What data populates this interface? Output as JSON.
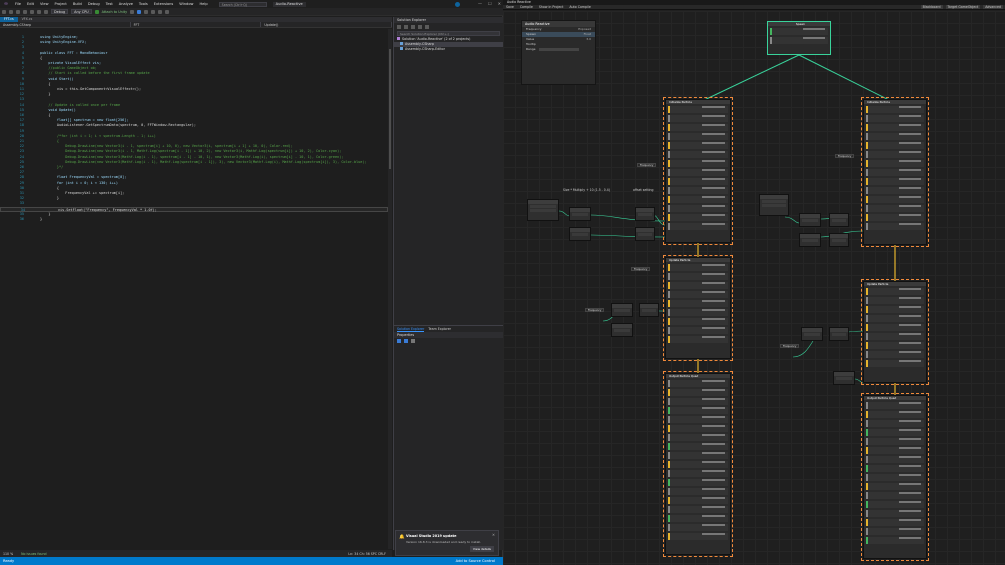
{
  "vs": {
    "menu": [
      "File",
      "Edit",
      "View",
      "Project",
      "Build",
      "Debug",
      "Test",
      "Analyze",
      "Tools",
      "Extensions",
      "Window",
      "Help"
    ],
    "search_placeholder": "Search (Ctrl+Q)",
    "title": "Audio-Reactive",
    "toolbar": {
      "config": "Debug",
      "platform": "Any CPU",
      "attach": "Attach to Unity"
    },
    "tabs": [
      "FFT.cs",
      "VFX.cs"
    ],
    "nav": {
      "project": "Assembly-CSharp",
      "class": "FFT",
      "member": "Update()"
    },
    "code": [
      {
        "n": "1",
        "t": "using UnityEngine;"
      },
      {
        "n": "2",
        "t": "using UnityEngine.VFX;"
      },
      {
        "n": "3",
        "t": ""
      },
      {
        "n": "4",
        "t": "public class FFT : MonoBehaviour"
      },
      {
        "n": "5",
        "t": "{"
      },
      {
        "n": "6",
        "t": "    private VisualEffect vis;"
      },
      {
        "n": "7",
        "t": "    //public GameObject ob;"
      },
      {
        "n": "8",
        "t": "    // Start is called before the first frame update"
      },
      {
        "n": "9",
        "t": "    void Start()"
      },
      {
        "n": "10",
        "t": "    {"
      },
      {
        "n": "11",
        "t": "        vis = this.GetComponent<VisualEffect>();"
      },
      {
        "n": "12",
        "t": "    }"
      },
      {
        "n": "13",
        "t": ""
      },
      {
        "n": "14",
        "t": "    // Update is called once per frame"
      },
      {
        "n": "15",
        "t": "    void Update()"
      },
      {
        "n": "16",
        "t": "    {"
      },
      {
        "n": "17",
        "t": "        float[] spectrum = new float[256];"
      },
      {
        "n": "18",
        "t": "        AudioListener.GetSpectrumData(spectrum, 0, FFTWindow.Rectangular);"
      },
      {
        "n": "19",
        "t": ""
      },
      {
        "n": "20",
        "t": "        /*for (int i = 1; i < spectrum.Length - 1; i++)"
      },
      {
        "n": "21",
        "t": "        {"
      },
      {
        "n": "22",
        "t": "            Debug.DrawLine(new Vector3(i - 1, spectrum[i] + 10, 0), new Vector3(i, spectrum[i + 1] + 10, 0), Color.red);"
      },
      {
        "n": "23",
        "t": "            Debug.DrawLine(new Vector3(i - 1, Mathf.Log(spectrum[i - 1]) + 10, 2), new Vector3(i, Mathf.Log(spectrum[i]) + 10, 2), Color.cyan);"
      },
      {
        "n": "24",
        "t": "            Debug.DrawLine(new Vector3(Mathf.Log(i - 1), spectrum[i - 1] - 10, 1), new Vector3(Mathf.Log(i), spectrum[i] - 10, 1), Color.green);"
      },
      {
        "n": "25",
        "t": "            Debug.DrawLine(new Vector3(Mathf.Log(i - 1), Mathf.Log(spectrum[i - 1]), 3), new Vector3(Mathf.Log(i), Mathf.Log(spectrum[i]), 3), Color.blue);"
      },
      {
        "n": "26",
        "t": "        }*/"
      },
      {
        "n": "27",
        "t": ""
      },
      {
        "n": "28",
        "t": "        float FrequencyVal = spectrum[0];"
      },
      {
        "n": "29",
        "t": "        for (int i = 0; i < 130; i++)"
      },
      {
        "n": "30",
        "t": "        {"
      },
      {
        "n": "31",
        "t": "            FrequencyVal += spectrum[i];"
      },
      {
        "n": "32",
        "t": "        }"
      },
      {
        "n": "33",
        "t": ""
      },
      {
        "n": "34",
        "t": "        vis.SetFloat(\"Frequency\", FrequencyVal * 1.0f);"
      },
      {
        "n": "35",
        "t": "    }"
      },
      {
        "n": "36",
        "t": "}"
      }
    ],
    "hints": {
      "class": "Unity Script | 0 references",
      "start": "Unity Message | 0 references",
      "update": "Unity Message | 0 references"
    },
    "bottombar": {
      "zoom": "110 %",
      "issues": "No issues found",
      "pos": "Ln: 34   Ch: 56   SPC   CRLF"
    },
    "status": {
      "left": "Ready",
      "right": "Add to Source Control"
    },
    "solution": {
      "title": "Solution Explorer",
      "search": "Search Solution Explorer (Ctrl+;)",
      "items": [
        "Solution 'Audio-Reactive' (2 of 2 projects)",
        "Assembly-CSharp",
        "Assembly-CSharp-Editor"
      ]
    },
    "properties": {
      "tabs": [
        "Solution Explorer",
        "Team Explorer"
      ],
      "title": "Properties"
    },
    "toast": {
      "title": "Visual Studio 2019 update",
      "msg": "Version 16.8.3 is downloaded and ready to install.",
      "button": "View details"
    }
  },
  "unity": {
    "title": "Audio Reactive",
    "toolbar": [
      "Save",
      "Compile",
      "Show in Project",
      "Auto Compile"
    ],
    "toolbar_right": [
      "Blackboard",
      "Target GameObject",
      "Advanced"
    ],
    "blackboard": {
      "title": "Audio Reactive",
      "rows": [
        {
          "label": "Frequency",
          "value": "Exposed"
        },
        {
          "label": "Spawn",
          "value": "Float"
        },
        {
          "label": "Value",
          "value": "3.0"
        },
        {
          "label": "Tooltip",
          "value": ""
        },
        {
          "label": "Range",
          "value": "0"
        }
      ]
    },
    "spawn_title": "Spawn",
    "context_titles": [
      "Initialize Particle",
      "Update Particle",
      "Output Particle Quad",
      "Initialize Particle",
      "Update Particle",
      "Output Particle Quad"
    ],
    "expr_label": "Size * Multiply + 10 (1.5 - 0.4)",
    "offset_label": "offset setting",
    "props": [
      "Frequency",
      "Frequency",
      "Frequency",
      "Frequency",
      "Frequency"
    ]
  },
  "colors": {
    "accent": "#007acc",
    "spawn_link": "#39d39b",
    "flow_link": "#e6b42d",
    "selection": "#f18a3b"
  }
}
